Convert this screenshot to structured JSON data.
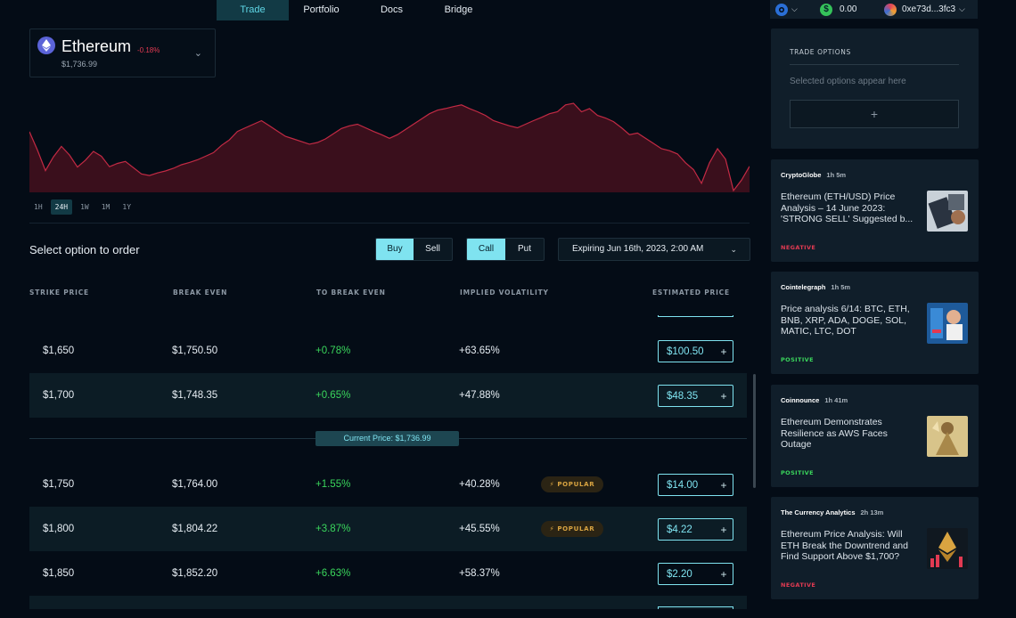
{
  "nav": {
    "tabs": [
      "Trade",
      "Portfolio",
      "Docs",
      "Bridge"
    ],
    "active": "Trade"
  },
  "wallet": {
    "balance": "0.00",
    "address": "0xe73d...3fc3"
  },
  "asset": {
    "name": "Ethereum",
    "change": "-0.18%",
    "price": "$1,736.99"
  },
  "time_ranges": [
    "1H",
    "24H",
    "1W",
    "1M",
    "1Y"
  ],
  "active_range": "24H",
  "order": {
    "prompt": "Select option to order",
    "side": [
      "Buy",
      "Sell"
    ],
    "type": [
      "Call",
      "Put"
    ],
    "expiry": "Expiring Jun 16th, 2023, 2:00 AM"
  },
  "table": {
    "headers": [
      "STRIKE PRICE",
      "BREAK EVEN",
      "TO BREAK EVEN",
      "IMPLIED VOLATILITY",
      "ESTIMATED PRICE"
    ],
    "rows_above": [
      {
        "strike": "$1,650",
        "break_even": "$1,750.50",
        "to_break_even": "+0.78%",
        "iv": "+63.65%",
        "price": "$100.50",
        "popular": false
      },
      {
        "strike": "$1,700",
        "break_even": "$1,748.35",
        "to_break_even": "+0.65%",
        "iv": "+47.88%",
        "price": "$48.35",
        "popular": false
      }
    ],
    "current_price": "Current Price: $1,736.99",
    "rows_below": [
      {
        "strike": "$1,750",
        "break_even": "$1,764.00",
        "to_break_even": "+1.55%",
        "iv": "+40.28%",
        "price": "$14.00",
        "popular": true
      },
      {
        "strike": "$1,800",
        "break_even": "$1,804.22",
        "to_break_even": "+3.87%",
        "iv": "+45.55%",
        "price": "$4.22",
        "popular": true
      },
      {
        "strike": "$1,850",
        "break_even": "$1,852.20",
        "to_break_even": "+6.63%",
        "iv": "+58.37%",
        "price": "$2.20",
        "popular": false
      }
    ],
    "popular_label": "⚡ POPULAR"
  },
  "trade_options": {
    "title": "TRADE OPTIONS",
    "placeholder": "Selected options appear here",
    "add": "+"
  },
  "news": [
    {
      "source": "CryptoGlobe",
      "time": "1h 5m",
      "title": "Ethereum (ETH/USD) Price Analysis – 14 June 2023: 'STRONG SELL' Suggested b...",
      "sentiment": "NEGATIVE"
    },
    {
      "source": "Cointelegraph",
      "time": "1h 5m",
      "title": "Price analysis 6/14: BTC, ETH, BNB, XRP, ADA, DOGE, SOL, MATIC, LTC, DOT",
      "sentiment": "POSITIVE"
    },
    {
      "source": "Coinnounce",
      "time": "1h 41m",
      "title": "Ethereum Demonstrates Resilience as AWS Faces Outage",
      "sentiment": "POSITIVE"
    },
    {
      "source": "The Currency Analytics",
      "time": "2h 13m",
      "title": "Ethereum Price Analysis: Will ETH Break the Downtrend and Find Support Above $1,700?",
      "sentiment": "NEGATIVE"
    }
  ],
  "colors": {
    "accent": "#7fe3f0",
    "positive": "#3ad65c",
    "negative": "#e23a52",
    "popular": "#d9a441",
    "chart_line": "#c22a44"
  },
  "price_series": [
    1747.2,
    1741.6,
    1735.3,
    1739.5,
    1742.7,
    1740.1,
    1736.4,
    1738.5,
    1741.2,
    1739.7,
    1736.5,
    1737.5,
    1738.1,
    1736.2,
    1734.3,
    1733.8,
    1734.6,
    1735.2,
    1736.0,
    1737.1,
    1737.8,
    1738.6,
    1739.7,
    1740.8,
    1743.0,
    1744.7,
    1747.3,
    1748.4,
    1749.5,
    1750.6,
    1749.0,
    1747.4,
    1745.8,
    1745.0,
    1744.2,
    1743.4,
    1743.9,
    1745.0,
    1746.6,
    1748.2,
    1749.0,
    1749.5,
    1748.4,
    1747.3,
    1746.3,
    1745.2,
    1746.3,
    1747.9,
    1749.5,
    1751.1,
    1752.7,
    1753.8,
    1754.3,
    1754.9,
    1755.4,
    1754.3,
    1753.3,
    1752.2,
    1750.6,
    1749.8,
    1749.0,
    1748.4,
    1749.5,
    1750.6,
    1751.6,
    1752.7,
    1753.3,
    1755.4,
    1755.9,
    1753.3,
    1754.3,
    1752.2,
    1751.4,
    1750.3,
    1748.4,
    1746.3,
    1746.8,
    1745.2,
    1743.6,
    1742.0,
    1741.4,
    1740.4,
    1737.7,
    1735.6,
    1731.4,
    1737.7,
    1742.0,
    1738.8,
    1729.2,
    1732.4,
    1736.6
  ]
}
